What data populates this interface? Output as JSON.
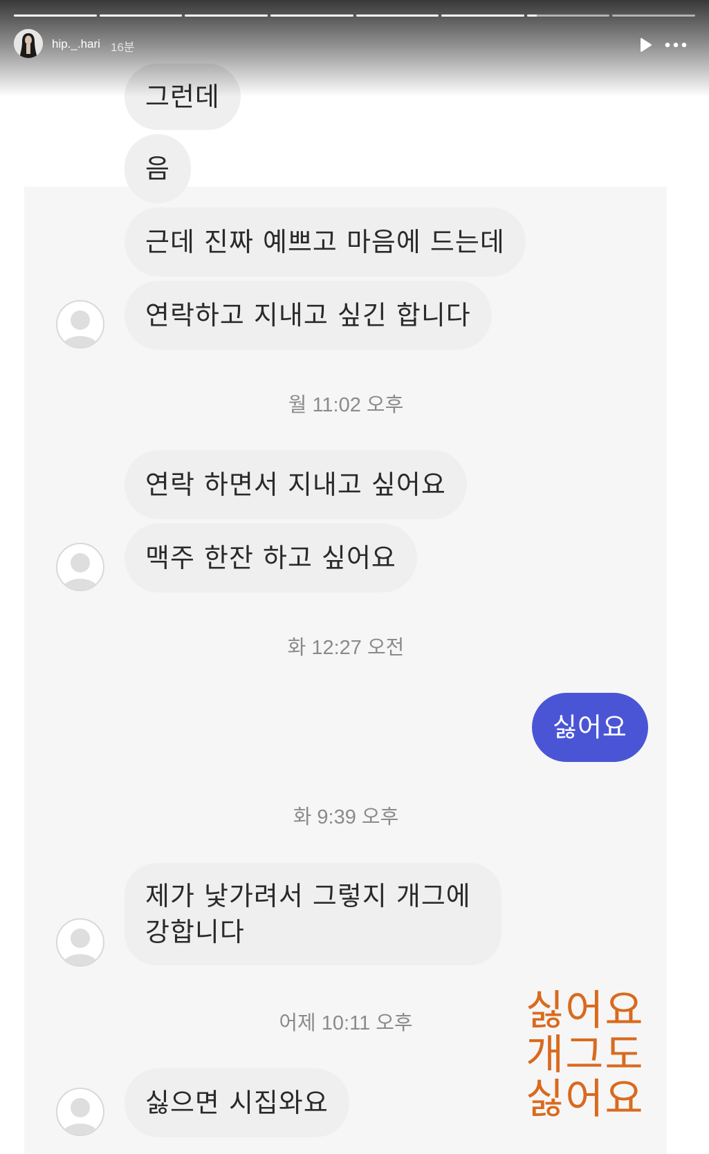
{
  "story": {
    "username": "hip._.hari",
    "time_ago": "16분",
    "progress_fractions": [
      1,
      1,
      1,
      1,
      1,
      1,
      0.12,
      0
    ]
  },
  "messages": {
    "m1": "그런데",
    "m2": "음",
    "m3": "근데 진짜 예쁘고 마음에 드는데",
    "m4": "연락하고 지내고 싶긴 합니다",
    "ts1": "월 11:02 오후",
    "m5": "연락 하면서 지내고 싶어요",
    "m6": "맥주 한잔 하고 싶어요",
    "ts2": "화 12:27 오전",
    "m7": "싫어요",
    "ts3": "화 9:39 오후",
    "m8": "제가 낯가려서 그렇지 개그에 강합니다",
    "ts4": "어제 10:11 오후",
    "m9": "싫으면 시집와요"
  },
  "overlay": {
    "line1": "싫어요",
    "line2": "개그도",
    "line3": "싫어요",
    "color": "#d96a1e"
  },
  "colors": {
    "my_bubble": "#4a55d6",
    "their_bubble": "#efefef"
  },
  "icons": {
    "play": "play-icon",
    "more": "more-icon",
    "default_avatar": "default-avatar-icon"
  }
}
